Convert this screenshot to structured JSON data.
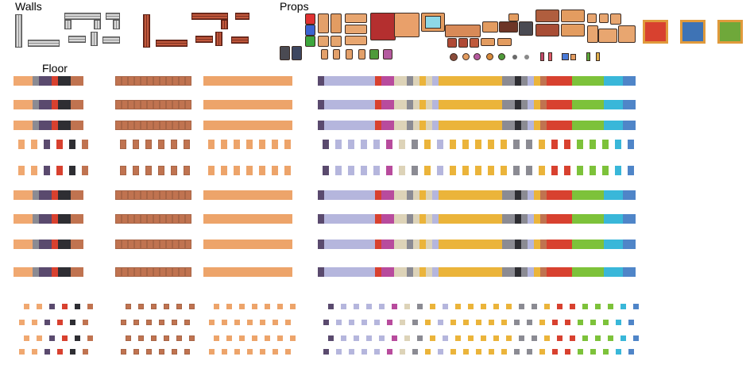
{
  "sheet": {
    "walls_label": "Walls",
    "props_label": "Props",
    "floor_label": "Floor"
  },
  "colors": {
    "wall_grey": "#d9d9d9",
    "wall_brick": "#c0583c",
    "floor_light_brick": "#f0a870",
    "floor_grey": "#8b8b93",
    "floor_purple": "#5a4a6e",
    "floor_red": "#d8412f",
    "floor_dark": "#2e2e33",
    "floor_wood": "#c07350",
    "floor_pale_wood": "#eda46a",
    "floor_lavender": "#b5b6dd",
    "floor_magenta": "#b84b9d",
    "floor_cream": "#ddd3b8",
    "floor_yellow": "#ebb43a",
    "floor_green": "#7dc23a",
    "floor_cyan": "#39b7d9",
    "floor_blue": "#4f85c8"
  },
  "rugs": [
    {
      "name": "red-rug",
      "color": "#d8412f"
    },
    {
      "name": "blue-rug",
      "color": "#3e73b5"
    },
    {
      "name": "green-rug",
      "color": "#6fa83a"
    }
  ]
}
